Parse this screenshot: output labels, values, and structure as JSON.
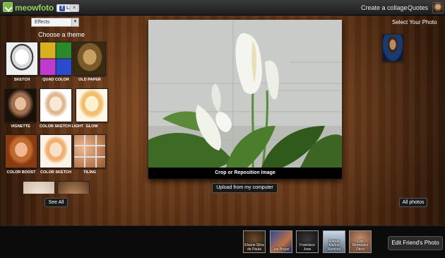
{
  "app": {
    "logo_text": "meowfoto",
    "fb_like_label": "Like",
    "fb_icon": "f"
  },
  "header": {
    "links": [
      "Create a collage",
      "Quotes"
    ]
  },
  "effects": {
    "selected": "Effects",
    "title": "Choose a theme",
    "themes": [
      {
        "label": "SKETCH"
      },
      {
        "label": "QUAD COLOR"
      },
      {
        "label": "OLD PAPER"
      },
      {
        "label": "VIGNETTE"
      },
      {
        "label": "COLOR SKETCH LIGHT"
      },
      {
        "label": "GLOW"
      },
      {
        "label": "COLOR BOOST"
      },
      {
        "label": "COLOR SKETCH"
      },
      {
        "label": "TILING"
      }
    ],
    "see_all_label": "See All"
  },
  "main": {
    "crop_label": "Crop or Reposition Image",
    "upload_label": "Upload from my computer"
  },
  "right": {
    "title": "Select Your Photo",
    "all_photos_label": "All photos"
  },
  "friends": [
    {
      "name": "Elvane Silva de Paula"
    },
    {
      "name": "Jan Braun"
    },
    {
      "name": "Francisco Jose"
    },
    {
      "name": "Rafael Muñoz Ramirez"
    },
    {
      "name": "Luis Bermúdez Otero"
    }
  ],
  "edit_friend_label": "Edit Friend's Photo"
}
